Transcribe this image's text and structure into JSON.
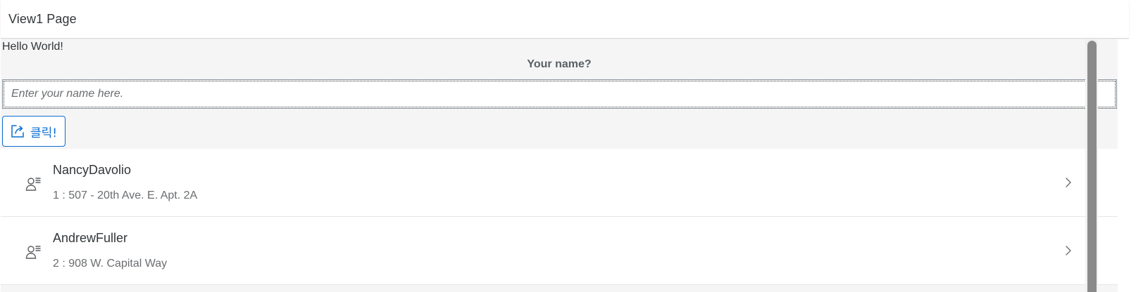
{
  "header": {
    "title": "View1 Page"
  },
  "main": {
    "greeting": "Hello World!",
    "question": "Your name?",
    "name_input": {
      "value": "",
      "placeholder": "Enter your name here."
    },
    "click_button": {
      "label": "클릭!",
      "icon": "share-icon"
    }
  },
  "list": {
    "items": [
      {
        "title": "NancyDavolio",
        "description": "1 : 507 - 20th Ave. E. Apt. 2A",
        "icon": "employee-icon"
      },
      {
        "title": "AndrewFuller",
        "description": "2 : 908 W. Capital Way",
        "icon": "employee-icon"
      }
    ]
  },
  "colors": {
    "accent": "#0a6ed1",
    "background": "#f5f5f5",
    "text": "#32363a",
    "secondary_text": "#6a6d70"
  }
}
